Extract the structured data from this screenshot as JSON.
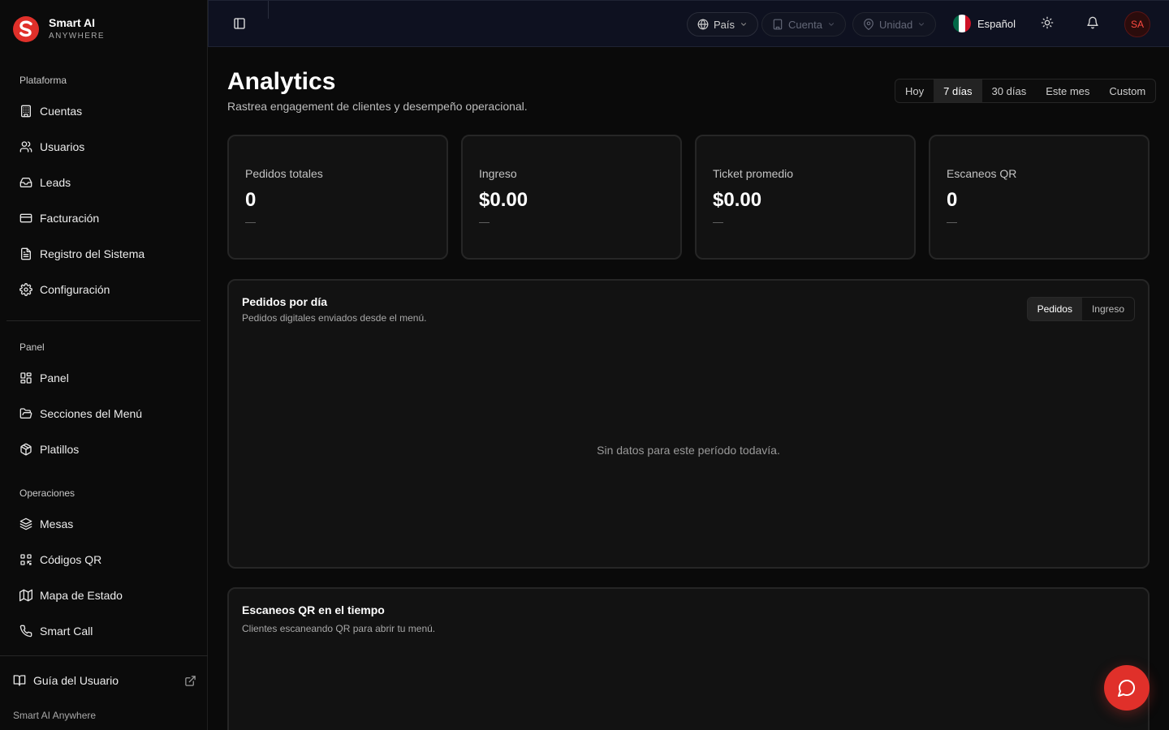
{
  "brand": {
    "name": "Smart AI",
    "tagline": "ANYWHERE"
  },
  "sidebar": {
    "groups": [
      {
        "label": "Plataforma",
        "items": [
          {
            "label": "Cuentas",
            "icon": "building-icon"
          },
          {
            "label": "Usuarios",
            "icon": "users-icon"
          },
          {
            "label": "Leads",
            "icon": "inbox-icon"
          },
          {
            "label": "Facturación",
            "icon": "credit-card-icon"
          },
          {
            "label": "Registro del Sistema",
            "icon": "file-text-icon"
          },
          {
            "label": "Configuración",
            "icon": "gear-icon"
          }
        ]
      },
      {
        "label": "Panel",
        "items": [
          {
            "label": "Panel",
            "icon": "dashboard-icon"
          },
          {
            "label": "Secciones del Menú",
            "icon": "folder-icon"
          },
          {
            "label": "Platillos",
            "icon": "package-icon"
          }
        ]
      },
      {
        "label": "Operaciones",
        "items": [
          {
            "label": "Mesas",
            "icon": "layers-icon"
          },
          {
            "label": "Códigos QR",
            "icon": "qr-code-icon"
          },
          {
            "label": "Mapa de Estado",
            "icon": "map-icon"
          },
          {
            "label": "Smart Call",
            "icon": "phone-icon"
          }
        ]
      }
    ],
    "guide_label": "Guía del Usuario",
    "footer": "Smart AI Anywhere"
  },
  "topbar": {
    "country": "País",
    "account": "Cuenta",
    "unit": "Unidad",
    "language": "Español",
    "avatar_initials": "SA"
  },
  "page": {
    "title": "Analytics",
    "subtitle": "Rastrea engagement de clientes y desempeño operacional.",
    "ranges": [
      "Hoy",
      "7 días",
      "30 días",
      "Este mes",
      "Custom"
    ],
    "active_range": "7 días"
  },
  "stats": [
    {
      "label": "Pedidos totales",
      "value": "0",
      "delta": "—"
    },
    {
      "label": "Ingreso",
      "value": "$0.00",
      "delta": "—"
    },
    {
      "label": "Ticket promedio",
      "value": "$0.00",
      "delta": "—"
    },
    {
      "label": "Escaneos QR",
      "value": "0",
      "delta": "—"
    }
  ],
  "orders_card": {
    "title": "Pedidos por día",
    "subtitle": "Pedidos digitales enviados desde el menú.",
    "toggle": [
      "Pedidos",
      "Ingreso"
    ],
    "empty": "Sin datos para este período todavía."
  },
  "qr_card": {
    "title": "Escaneos QR en el tiempo",
    "subtitle": "Clientes escaneando QR para abrir tu menú."
  },
  "colors": {
    "accent": "#e0302a",
    "background": "#0a0a0a",
    "card": "#121212",
    "topbar": "#0e1120"
  }
}
